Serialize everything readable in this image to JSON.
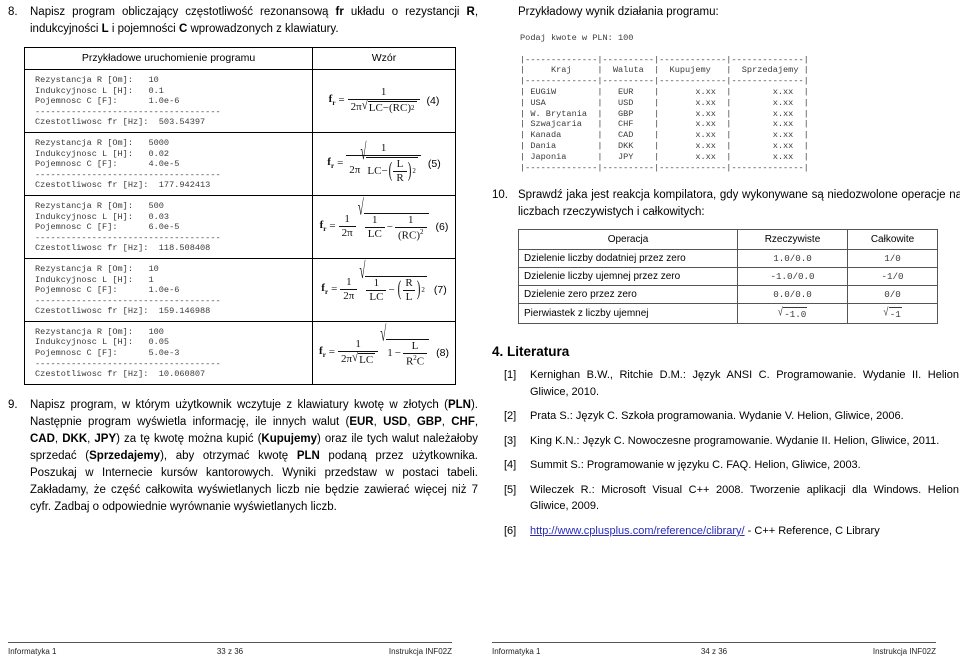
{
  "left": {
    "question8": {
      "number": "8.",
      "text_parts": [
        {
          "t": "Napisz program obliczający częstotliwość rezonansową "
        },
        {
          "t": "fr",
          "b": true
        },
        {
          "t": " układu o rezystancji "
        },
        {
          "t": "R",
          "b": true
        },
        {
          "t": ", indukcyjności "
        },
        {
          "t": "L",
          "b": true
        },
        {
          "t": " i pojemności "
        },
        {
          "t": "C",
          "b": true
        },
        {
          "t": " wprowadzonych z klawiatury."
        }
      ],
      "plain": "Napisz program obliczający częstotliwość rezonansową fr układu o rezystancji R, indukcyjności L i pojemności C wprowadzonych z klawiatury."
    },
    "table": {
      "headers": [
        "Przykładowe uruchomienie programu",
        "Wzór"
      ],
      "rows": [
        {
          "run": "Rezystancja R [Om]:   10\nIndukcyjnosc L [H]:   0.1\nPojemnosc C [F]:      1.0e-6\n------------------------------------\nCzestotliwosc fr [Hz]:  503.54397",
          "eq_number": "(4)",
          "formula_latex": "f_r = 1 / (2*pi*sqrt(LC - (RC)^2))"
        },
        {
          "run": "Rezystancja R [Om]:   5000\nIndukcyjnosc L [H]:   0.02\nPojemnosc C [F]:      4.0e-5\n------------------------------------\nCzestotliwosc fr [Hz]:  177.942413",
          "eq_number": "(5)",
          "formula_latex": "f_r = 1 / (2*pi*sqrt(LC - (L/R)^2))"
        },
        {
          "run": "Rezystancja R [Om]:   500\nIndukcyjnosc L [H]:   0.03\nPojemnosc C [F]:      6.0e-5\n------------------------------------\nCzestotliwosc fr [Hz]:  118.508408",
          "eq_number": "(6)",
          "formula_latex": "f_r = (1/(2*pi)) * sqrt(1/LC - 1/(RC)^2)"
        },
        {
          "run": "Rezystancja R [Om]:   10\nIndukcyjnosc L [H]:   1\nPojemnosc C [F]:      1.0e-6\n------------------------------------\nCzestotliwosc fr [Hz]:  159.146988",
          "eq_number": "(7)",
          "formula_latex": "f_r = (1/(2*pi)) * sqrt(1/LC - (R/L)^2)"
        },
        {
          "run": "Rezystancja R [Om]:   100\nIndukcyjnosc L [H]:   0.05\nPojemnosc C [F]:      5.0e-3\n------------------------------------\nCzestotliwosc fr [Hz]:  10.060807",
          "eq_number": "(8)",
          "formula_latex": "f_r = (1/(2*pi*sqrt(LC))) * sqrt(1 - L/(R^2 C))"
        }
      ]
    },
    "question9": {
      "number": "9.",
      "plain": "Napisz program, w którym użytkownik wczytuje z klawiatury kwotę w złotych (PLN). Następnie program wyświetla informację, ile innych walut (EUR, USD, GBP, CHF, CAD, DKK, JPY) za tę kwotę można kupić (Kupujemy) oraz ile tych walut należałoby sprzedać (Sprzedajemy), aby otrzymać kwotę PLN podaną przez użytkownika. Poszukaj w Internecie kursów kantorowych. Wyniki przedstaw w postaci tabeli. Zakładamy, że część całkowita wyświetlanych liczb nie będzie zawierać więcej niż 7 cyfr. Zadbaj o odpowiednie wyrównanie wyświetlanych liczb."
    },
    "footer": {
      "left": "Informatyka 1",
      "center": "33 z 36",
      "right": "Instrukcja INF02Z"
    }
  },
  "right": {
    "sample_output_label": "Przykładowy wynik działania programu:",
    "console": "Podaj kwote w PLN: 100\n\n|--------------|----------|-------------|--------------|\n|     Kraj     |  Waluta  |  Kupujemy   |  Sprzedajemy |\n|--------------|----------|-------------|--------------|\n| EUGiW        |   EUR    |       x.xx  |        x.xx  |\n| USA          |   USD    |       x.xx  |        x.xx  |\n| W. Brytania  |   GBP    |       x.xx  |        x.xx  |\n| Szwajcaria   |   CHF    |       x.xx  |        x.xx  |\n| Kanada       |   CAD    |       x.xx  |        x.xx  |\n| Dania        |   DKK    |       x.xx  |        x.xx  |\n| Japonia      |   JPY    |       x.xx  |        x.xx  |\n|--------------|----------|-------------|--------------|",
    "console_table": {
      "headers": [
        "Kraj",
        "Waluta",
        "Kupujemy",
        "Sprzedajemy"
      ],
      "rows": [
        [
          "EUGiW",
          "EUR",
          "x.xx",
          "x.xx"
        ],
        [
          "USA",
          "USD",
          "x.xx",
          "x.xx"
        ],
        [
          "W. Brytania",
          "GBP",
          "x.xx",
          "x.xx"
        ],
        [
          "Szwajcaria",
          "CHF",
          "x.xx",
          "x.xx"
        ],
        [
          "Kanada",
          "CAD",
          "x.xx",
          "x.xx"
        ],
        [
          "Dania",
          "DKK",
          "x.xx",
          "x.xx"
        ],
        [
          "Japonia",
          "JPY",
          "x.xx",
          "x.xx"
        ]
      ],
      "prompt": "Podaj kwote w PLN: 100"
    },
    "question10": {
      "number": "10.",
      "plain": "Sprawdź jaka jest reakcja kompilatora, gdy wykonywane są niedozwolone operacje na liczbach rzeczywistych i całkowitych:"
    },
    "ops_table": {
      "headers": [
        "Operacja",
        "Rzeczywiste",
        "Całkowite"
      ],
      "rows": [
        {
          "op": "Dzielenie liczby dodatniej przez zero",
          "real": "1.0/0.0",
          "int": "1/0",
          "real_sqrt": false,
          "int_sqrt": false
        },
        {
          "op": "Dzielenie liczby ujemnej przez zero",
          "real": "-1.0/0.0",
          "int": "-1/0",
          "real_sqrt": false,
          "int_sqrt": false
        },
        {
          "op": "Dzielenie zero przez zero",
          "real": "0.0/0.0",
          "int": "0/0",
          "real_sqrt": false,
          "int_sqrt": false
        },
        {
          "op": "Pierwiastek z liczby ujemnej",
          "real": "-1.0",
          "int": "-1",
          "real_sqrt": true,
          "int_sqrt": true
        }
      ]
    },
    "literature": {
      "heading": "4. Literatura",
      "items": [
        {
          "num": "[1]",
          "text": "Kernighan B.W., Ritchie D.M.: Język ANSI C. Programowanie. Wydanie II. Helion, Gliwice, 2010.",
          "link": null,
          "after": null
        },
        {
          "num": "[2]",
          "text": "Prata S.: Język C. Szkoła programowania. Wydanie V. Helion, Gliwice, 2006.",
          "link": null,
          "after": null
        },
        {
          "num": "[3]",
          "text": "King K.N.: Język C. Nowoczesne programowanie. Wydanie II. Helion, Gliwice, 2011.",
          "link": null,
          "after": null
        },
        {
          "num": "[4]",
          "text": "Summit S.: Programowanie w języku C. FAQ. Helion, Gliwice, 2003.",
          "link": null,
          "after": null
        },
        {
          "num": "[5]",
          "text": "Wileczek R.: Microsoft Visual C++ 2008. Tworzenie aplikacji dla Windows. Helion, Gliwice, 2009.",
          "link": null,
          "after": null
        },
        {
          "num": "[6]",
          "text": "",
          "link": "http://www.cplusplus.com/reference/clibrary/",
          "after": " - C++ Reference, C Library"
        }
      ]
    },
    "footer": {
      "left": "Informatyka 1",
      "center": "34 z 36",
      "right": "Instrukcja INF02Z"
    }
  }
}
